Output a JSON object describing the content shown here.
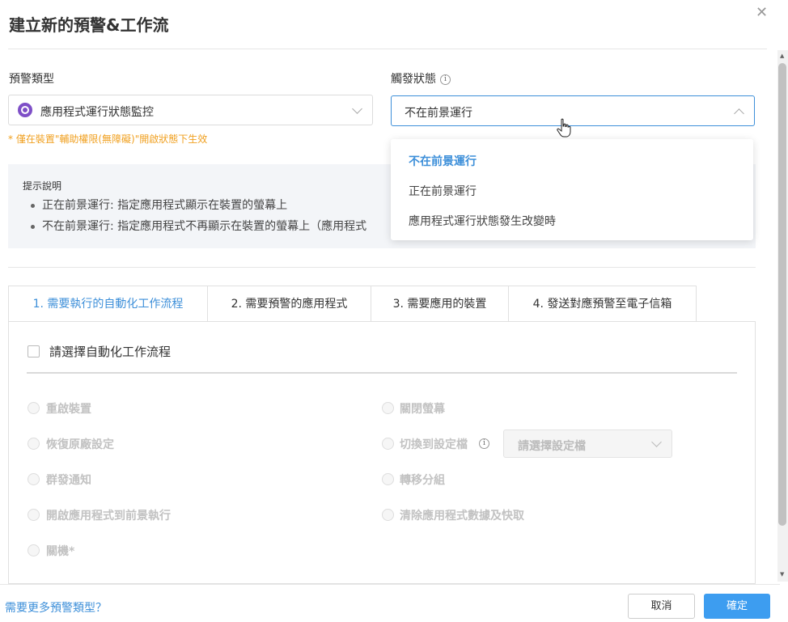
{
  "dialog": {
    "title": "建立新的預警&工作流",
    "close_icon": "close-icon"
  },
  "alert_type": {
    "label": "預警類型",
    "value": "應用程式運行狀態監控",
    "icon": "app-status-icon",
    "warning": "* 僅在裝置\"輔助權限(無障礙)\"開啟狀態下生效"
  },
  "trigger_state": {
    "label": "觸發狀態",
    "info_icon": "info-icon",
    "value": "不在前景運行",
    "options": [
      "不在前景運行",
      "正在前景運行",
      "應用程式運行狀態發生改變時"
    ],
    "selected_index": 0
  },
  "hint": {
    "title": "提示說明",
    "lines": [
      "正在前景運行: 指定應用程式顯示在裝置的螢幕上",
      "不在前景運行: 指定應用程式不再顯示在裝置的螢幕上（應用程式"
    ]
  },
  "tabs": [
    {
      "label": "1. 需要執行的自動化工作流程",
      "active": true
    },
    {
      "label": "2. 需要預警的應用程式",
      "active": false
    },
    {
      "label": "3. 需要應用的裝置",
      "active": false
    },
    {
      "label": "4. 發送對應預警至電子信箱",
      "active": false
    }
  ],
  "workflow": {
    "select_all_label": "請選擇自動化工作流程",
    "actions_left": [
      "重啟裝置",
      "恢復原廠設定",
      "群發通知",
      "開啟應用程式到前景執行",
      "關機*"
    ],
    "actions_right": [
      "關閉螢幕",
      "切換到設定檔",
      "轉移分組",
      "清除應用程式數據及快取"
    ],
    "profile_select_placeholder": "請選擇設定檔"
  },
  "footer": {
    "more_link": "需要更多預警類型？",
    "cancel_label": "取消",
    "ok_label": "確定"
  },
  "colors": {
    "accent": "#3d8fd9",
    "primary_button": "#3d9df0",
    "warning": "#f0a020",
    "app_icon": "#7e4fc7"
  }
}
